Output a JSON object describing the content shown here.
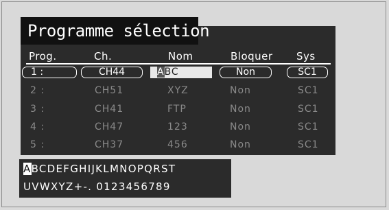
{
  "title": "Programme sélection",
  "columns": [
    "Prog.",
    "Ch.",
    "Nom",
    "Bloquer",
    "Sys"
  ],
  "rows": [
    {
      "prog": "1 :",
      "ch": "CH44",
      "nom": "ABC",
      "bloquer": "Non",
      "sys": "SC1",
      "selected": true
    },
    {
      "prog": "2 :",
      "ch": "CH51",
      "nom": "XYZ",
      "bloquer": "Non",
      "sys": "SC1"
    },
    {
      "prog": "3 :",
      "ch": "CH41",
      "nom": "FTP",
      "bloquer": "Non",
      "sys": "SC1"
    },
    {
      "prog": "4 :",
      "ch": "CH47",
      "nom": "123",
      "bloquer": "Non",
      "sys": "SC1"
    },
    {
      "prog": "5 :",
      "ch": "CH37",
      "nom": "456",
      "bloquer": "Non",
      "sys": "SC1"
    }
  ],
  "name_edit": {
    "cursor_char": "A",
    "rest": "BC"
  },
  "keyboard": {
    "row1_cursor": "A",
    "row1_rest": "BCDEFGHIJKLMNOPQRST",
    "row2": "UVWXYZ+-. 0123456789"
  }
}
